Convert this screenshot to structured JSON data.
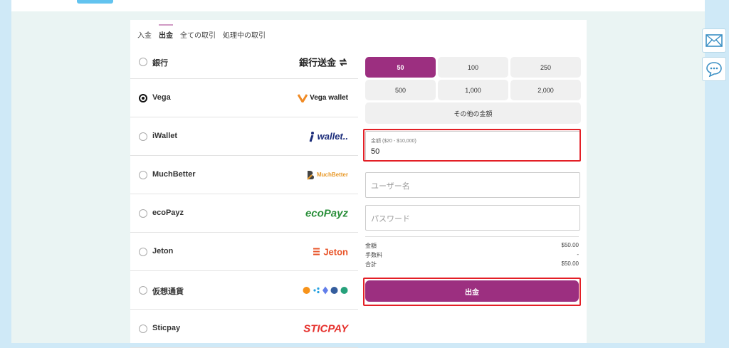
{
  "tabs": [
    {
      "label": "入金",
      "active": false
    },
    {
      "label": "出金",
      "active": true
    },
    {
      "label": "全ての取引",
      "active": false
    },
    {
      "label": "処理中の取引",
      "active": false
    }
  ],
  "methods": [
    {
      "name": "銀行",
      "logo_text": "銀行送金",
      "selected": false
    },
    {
      "name": "Vega",
      "logo_text": "Vega wallet",
      "selected": true
    },
    {
      "name": "iWallet",
      "logo_text": "wallet..",
      "selected": false
    },
    {
      "name": "MuchBetter",
      "logo_text": "MuchBetter",
      "selected": false
    },
    {
      "name": "ecoPayz",
      "logo_text": "ecoPayz",
      "selected": false
    },
    {
      "name": "Jeton",
      "logo_text": "Jeton",
      "selected": false
    },
    {
      "name": "仮想通貨",
      "logo_text": "",
      "selected": false
    },
    {
      "name": "Sticpay",
      "logo_text": "STICPAY",
      "selected": false
    }
  ],
  "amounts": [
    "50",
    "100",
    "250",
    "500",
    "1,000",
    "2,000"
  ],
  "selected_amount": "50",
  "other_amount_label": "その他の金額",
  "amount_field": {
    "label": "金額 ($20 - $10,000)",
    "value": "50"
  },
  "username_placeholder": "ユーザー名",
  "password_placeholder": "パスワード",
  "summary": [
    {
      "label": "金額",
      "value": "$50.00"
    },
    {
      "label": "手数料",
      "value": "-"
    },
    {
      "label": "合計",
      "value": "$50.00"
    }
  ],
  "submit_label": "出金",
  "colors": {
    "accent": "#9c2f80",
    "highlight": "#e31f26",
    "background": "#cfe9f7"
  }
}
